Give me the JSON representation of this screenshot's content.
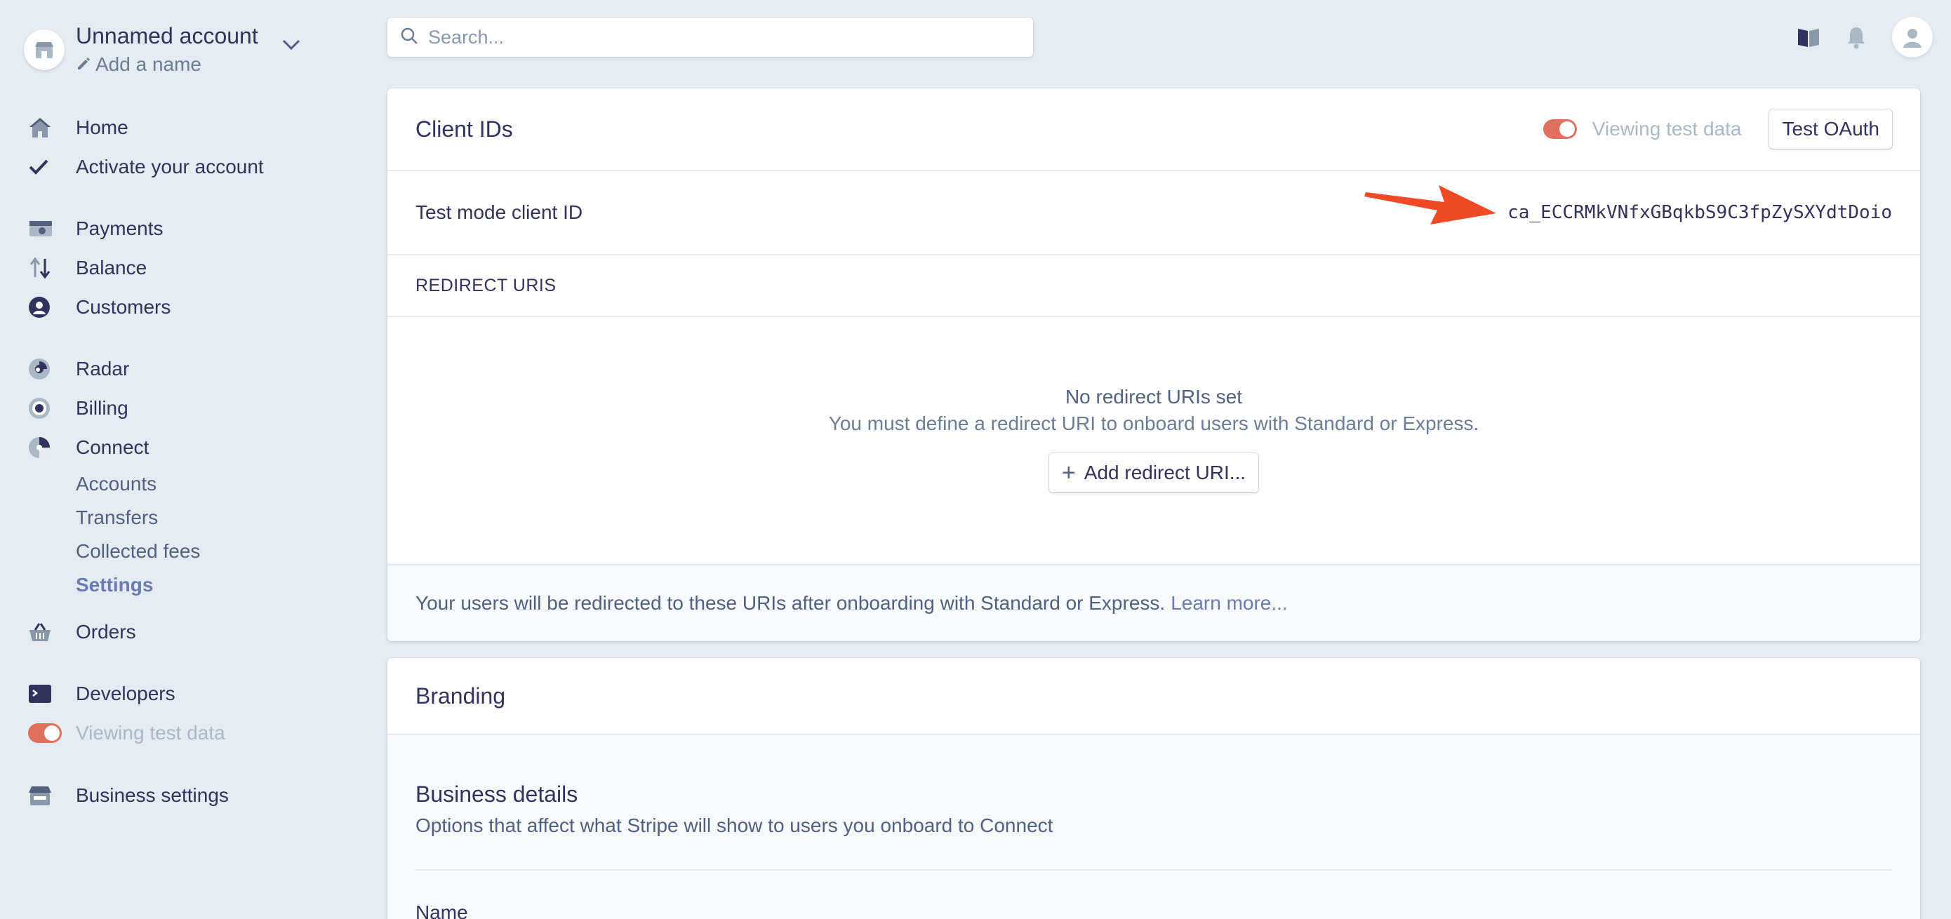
{
  "account": {
    "name": "Unnamed account",
    "add_name": "Add a name"
  },
  "search": {
    "placeholder": "Search..."
  },
  "sidebar": {
    "items": [
      {
        "label": "Home",
        "icon": "home-icon"
      },
      {
        "label": "Activate your account",
        "icon": "checkmark-icon"
      },
      {
        "label": "Payments",
        "icon": "payments-icon"
      },
      {
        "label": "Balance",
        "icon": "balance-arrows-icon"
      },
      {
        "label": "Customers",
        "icon": "customer-icon"
      },
      {
        "label": "Radar",
        "icon": "radar-icon"
      },
      {
        "label": "Billing",
        "icon": "billing-icon"
      },
      {
        "label": "Connect",
        "icon": "connect-icon"
      },
      {
        "label": "Orders",
        "icon": "orders-basket-icon"
      },
      {
        "label": "Developers",
        "icon": "terminal-icon"
      },
      {
        "label": "Viewing test data",
        "icon": "toggle"
      },
      {
        "label": "Business settings",
        "icon": "store-icon"
      }
    ],
    "connect_sub": [
      "Accounts",
      "Transfers",
      "Collected fees",
      "Settings"
    ]
  },
  "client_ids": {
    "title": "Client IDs",
    "viewing_test_data": "Viewing test data",
    "test_oauth": "Test OAuth",
    "test_mode_label": "Test mode client ID",
    "client_id": "ca_ECCRMkVNfxGBqkbS9C3fpZySXYdtDoio",
    "redirect_header": "REDIRECT URIS",
    "empty_title": "No redirect URIs set",
    "empty_desc": "You must define a redirect URI to onboard users with Standard or Express.",
    "add_button": "Add redirect URI...",
    "footer_text": "Your users will be redirected to these URIs after onboarding with Standard or Express.",
    "learn_more": "Learn more..."
  },
  "branding": {
    "title": "Branding",
    "business_details_title": "Business details",
    "business_details_desc": "Options that affect what Stripe will show to users you onboard to Connect",
    "name_label": "Name"
  },
  "colors": {
    "background": "#e6ebf1",
    "toggle_on": "#e0705d",
    "arrow": "#ef4a23",
    "link": "#6b7bb0"
  }
}
